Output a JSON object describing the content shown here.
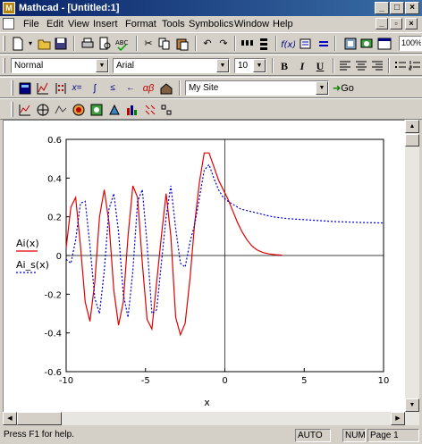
{
  "window": {
    "title": "Mathcad - [Untitled:1]",
    "app_icon": "mathcad-icon",
    "minimize": "_",
    "maximize": "□",
    "close": "×"
  },
  "menu": {
    "items": [
      "File",
      "Edit",
      "View",
      "Insert",
      "Format",
      "Tools",
      "Symbolics",
      "Window",
      "Help"
    ],
    "mdi": {
      "minimize": "_",
      "restore": "▫",
      "close": "×"
    }
  },
  "standard_toolbar": {
    "zoom": "100%"
  },
  "formatting_toolbar": {
    "style": "Normal",
    "font": "Arial",
    "size": "10",
    "bold": "B",
    "italic": "I",
    "underline": "U"
  },
  "math_toolbar": {
    "resource_combo": "My Site",
    "go_label": "Go"
  },
  "plot": {
    "legend": [
      "Ai(x)",
      "Ai_s(x)"
    ],
    "x_axis_label": "x"
  },
  "chart_data": {
    "type": "line",
    "xlim": [
      -10,
      10
    ],
    "ylim": [
      -0.6,
      0.6
    ],
    "x_ticks": [
      -10,
      -5,
      0,
      5,
      10
    ],
    "x_tick_labels": [
      "-10",
      "-5",
      "0",
      "5",
      "10"
    ],
    "y_ticks": [
      -0.6,
      -0.4,
      -0.2,
      0,
      0.2,
      0.4,
      0.6
    ],
    "y_tick_labels": [
      "-0.6",
      "-0.4",
      "-0.2",
      "0",
      "0.2",
      "0.4",
      "0.6"
    ],
    "xlabel": "x",
    "series": [
      {
        "name": "Ai(x)",
        "color": "#e00000",
        "style": "solid",
        "x": [
          -10,
          -9.7,
          -9.4,
          -9.1,
          -8.8,
          -8.5,
          -8.2,
          -7.9,
          -7.6,
          -7.3,
          -7.0,
          -6.7,
          -6.4,
          -6.1,
          -5.8,
          -5.5,
          -5.2,
          -4.9,
          -4.6,
          -4.3,
          -4.0,
          -3.7,
          -3.4,
          -3.1,
          -2.8,
          -2.5,
          -2.2,
          -1.9,
          -1.6,
          -1.3,
          -1.0,
          -0.7,
          -0.4,
          -0.1,
          0.2,
          0.5,
          0.8,
          1.1,
          1.4,
          1.7,
          2.0,
          2.4,
          2.8,
          3.2,
          3.6
        ],
        "y": [
          0.04,
          0.25,
          0.3,
          0.05,
          -0.24,
          -0.34,
          -0.14,
          0.2,
          0.34,
          0.17,
          -0.18,
          -0.36,
          -0.24,
          0.1,
          0.36,
          0.3,
          -0.04,
          -0.33,
          -0.38,
          -0.14,
          0.1,
          0.32,
          0.1,
          -0.32,
          -0.41,
          -0.35,
          -0.12,
          0.17,
          0.38,
          0.53,
          0.53,
          0.46,
          0.39,
          0.34,
          0.29,
          0.23,
          0.17,
          0.12,
          0.08,
          0.05,
          0.03,
          0.015,
          0.008,
          0.004,
          0.002
        ]
      },
      {
        "name": "Ai_s(x)",
        "color": "#0000d0",
        "style": "dotted",
        "x": [
          -10,
          -9.7,
          -9.4,
          -9.1,
          -8.8,
          -8.5,
          -8.2,
          -7.9,
          -7.6,
          -7.3,
          -7.0,
          -6.7,
          -6.4,
          -6.1,
          -5.8,
          -5.5,
          -5.2,
          -4.9,
          -4.6,
          -4.3,
          -4.0,
          -3.7,
          -3.4,
          -3.1,
          -2.8,
          -2.5,
          -2.2,
          -1.9,
          -1.6,
          -1.3,
          -1.0,
          -0.7,
          -0.4,
          -0.1,
          0.2,
          0.6,
          1.0,
          1.5,
          2.0,
          3.0,
          4.0,
          5.0,
          6.0,
          7.0,
          8.0,
          9.0,
          10.0
        ],
        "y": [
          -0.02,
          -0.04,
          0.08,
          0.27,
          0.28,
          0.05,
          -0.22,
          -0.3,
          -0.08,
          0.24,
          0.32,
          0.12,
          -0.2,
          -0.32,
          -0.08,
          0.28,
          0.34,
          0.06,
          -0.3,
          -0.28,
          -0.04,
          0.2,
          0.36,
          0.14,
          -0.04,
          -0.06,
          0.07,
          0.16,
          0.3,
          0.44,
          0.47,
          0.4,
          0.34,
          0.3,
          0.28,
          0.26,
          0.24,
          0.23,
          0.22,
          0.2,
          0.19,
          0.185,
          0.18,
          0.175,
          0.172,
          0.17,
          0.168
        ]
      }
    ]
  },
  "status": {
    "message": "Press F1 for help.",
    "auto": "AUTO",
    "num": "NUM",
    "page": "Page 1"
  }
}
